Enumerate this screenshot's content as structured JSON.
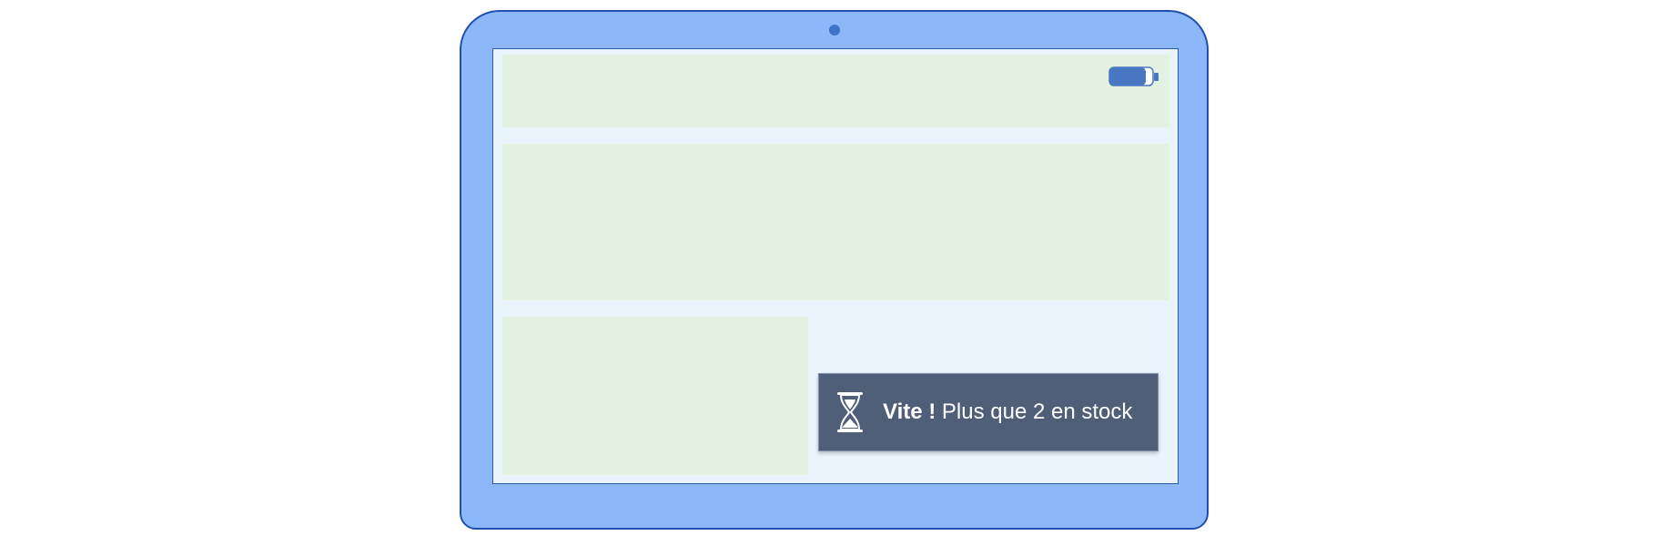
{
  "notification": {
    "emphasis": "Vite !",
    "message": "Plus que 2 en stock",
    "icon": "hourglass-icon"
  },
  "status_bar": {
    "battery_icon": "battery-icon"
  },
  "colors": {
    "device_frame": "#8cb8fa",
    "device_border": "#1f4fb0",
    "screen_background": "#eaf4fd",
    "placeholder_block": "#e3f2e0",
    "toast_background": "#4e5f77",
    "toast_text": "#ffffff",
    "battery_fill": "#4a77c4"
  }
}
